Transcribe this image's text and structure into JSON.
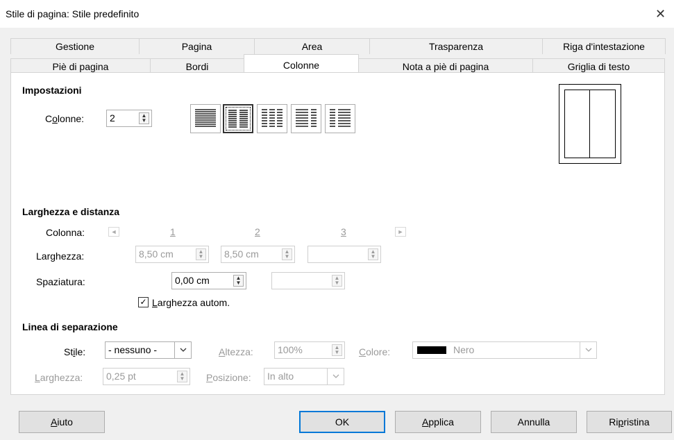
{
  "window": {
    "title": "Stile di pagina: Stile predefinito",
    "close_glyph": "✕"
  },
  "tabs_row1": [
    "Gestione",
    "Pagina",
    "Area",
    "Trasparenza",
    "Riga d'intestazione"
  ],
  "tabs_row2": [
    "Piè di pagina",
    "Bordi",
    "Colonne",
    "Nota a piè di pagina",
    "Griglia di testo"
  ],
  "active_tab": "Colonne",
  "impostazioni": {
    "heading": "Impostazioni",
    "colonne_label_pre": "C",
    "colonne_label_u": "o",
    "colonne_label_post": "lonne:",
    "colonne_value": "2",
    "selected_layout": 2
  },
  "larghezza_distanza": {
    "heading": "Larghezza e distanza",
    "colonna_label": "Colonna:",
    "col_numbers": [
      "1",
      "2",
      "3"
    ],
    "larghezza_label_pre": "Lar",
    "larghezza_label_u": "g",
    "larghezza_label_post": "hezza:",
    "width1": "8,50 cm",
    "width2": "8,50 cm",
    "width3": "",
    "spaziatura_label": "Spaziatura:",
    "spacing1": "0,00 cm",
    "spacing2": "",
    "auto_width_u": "L",
    "auto_width_post": "arghezza autom.",
    "auto_width_checked": true
  },
  "linea_separazione": {
    "heading": "Linea di separazione",
    "stile_label_pre": "St",
    "stile_label_u": "i",
    "stile_label_post": "le:",
    "stile_value": "- nessuno -",
    "altezza_label_u": "A",
    "altezza_label_post": "ltezza:",
    "altezza_value": "100%",
    "colore_label_u": "C",
    "colore_label_post": "olore:",
    "colore_value": "Nero",
    "colore_swatch": "#000000",
    "larghezza_label_u": "L",
    "larghezza_label_post": "arghezza:",
    "larghezza_value": "0,25 pt",
    "posizione_label_u": "P",
    "posizione_label_post": "osizione:",
    "posizione_value": "In alto"
  },
  "buttons": {
    "aiuto_u": "A",
    "aiuto_post": "iuto",
    "ok": "OK",
    "applica_u": "A",
    "applica_post": "pplica",
    "annulla": "Annulla",
    "ripristina_pre": "Ri",
    "ripristina_u": "p",
    "ripristina_post": "ristina"
  },
  "colors": {
    "accent": "#0078d7"
  }
}
